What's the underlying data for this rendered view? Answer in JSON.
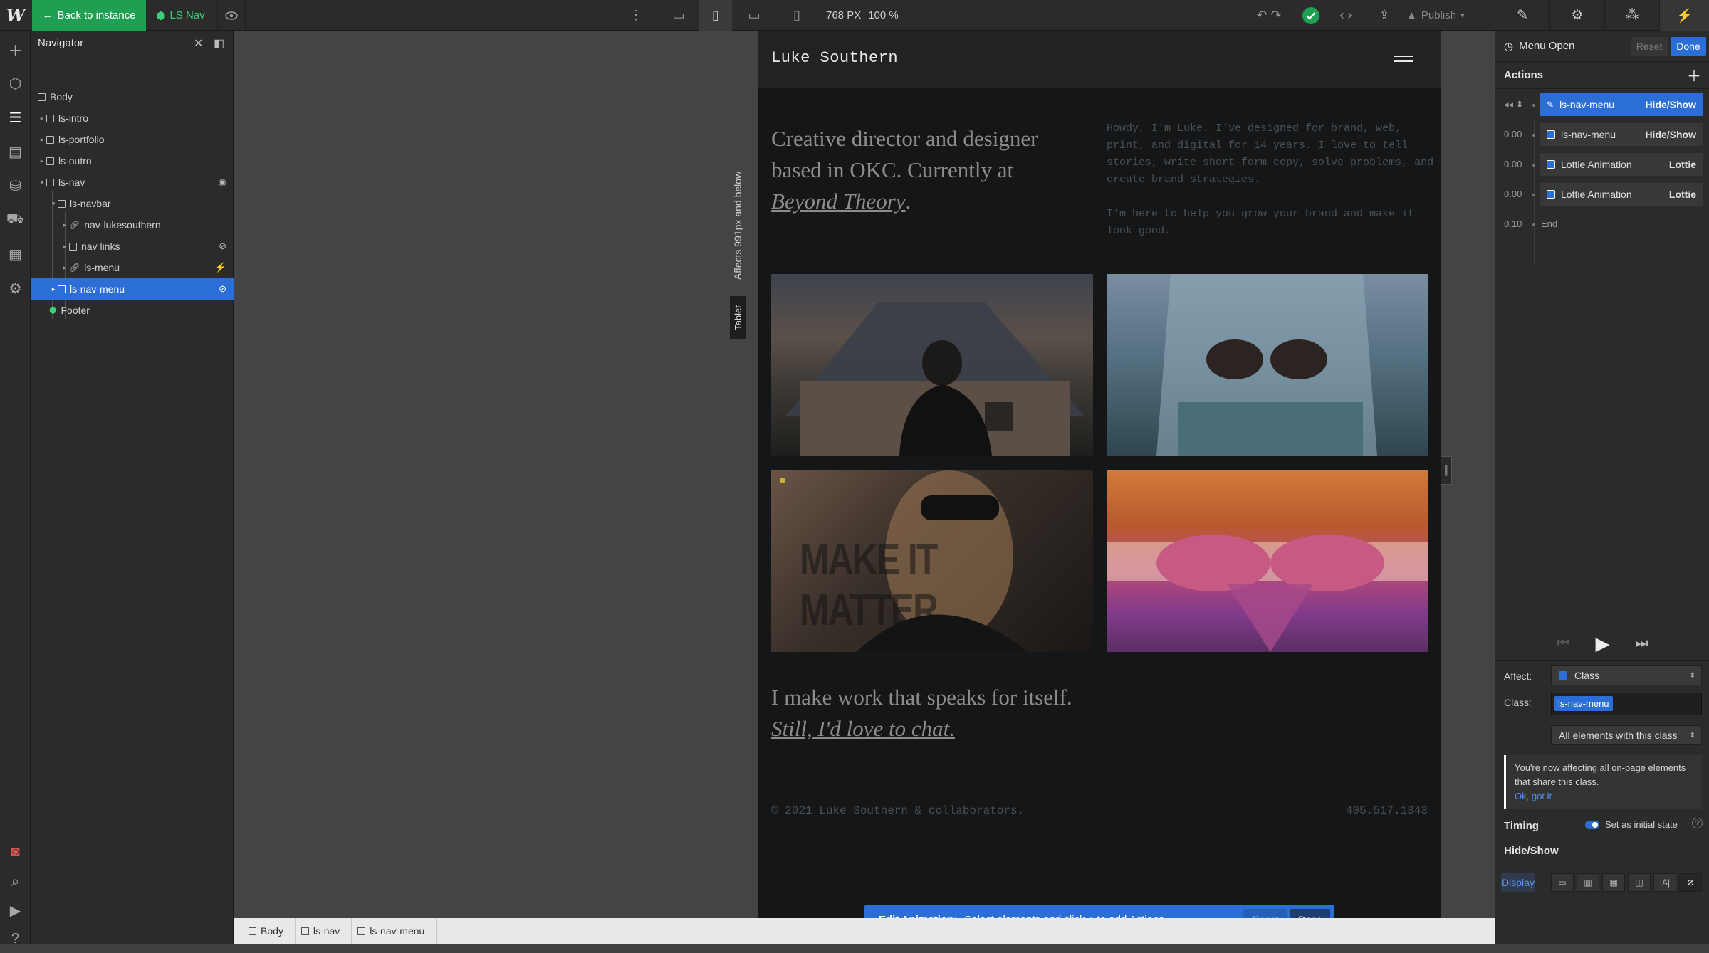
{
  "topbar": {
    "logo": "W",
    "back_label": "Back to instance",
    "symbol_name": "LS Nav",
    "canvas_width": "768 PX",
    "zoom": "100 %",
    "publish_label": "Publish"
  },
  "navigator": {
    "title": "Navigator",
    "items": [
      {
        "label": "Body"
      },
      {
        "label": "ls-intro"
      },
      {
        "label": "ls-portfolio"
      },
      {
        "label": "ls-outro"
      },
      {
        "label": "ls-nav"
      },
      {
        "label": "ls-navbar"
      },
      {
        "label": "nav-lukesouthern"
      },
      {
        "label": "nav links"
      },
      {
        "label": "ls-menu"
      },
      {
        "label": "ls-nav-menu"
      },
      {
        "label": "Footer"
      }
    ]
  },
  "breakpoint": {
    "affects": "Affects 991px and below",
    "device": "Tablet"
  },
  "site": {
    "brand": "Luke Southern",
    "hero_line1": "Creative director and designer based in OKC. Currently at",
    "hero_link": "Beyond Theory",
    "hero_end": ".",
    "intro_p1": "Howdy, I'm Luke. I've designed for brand, web, print, and digital for 14 years. I love to tell stories, write short form copy, solve problems, and create brand strategies.",
    "intro_p2": "I'm here to help you grow your brand and make it look good.",
    "photo3_text": "MAKE IT MATTER",
    "cta_line1": "I make work that speaks for itself.",
    "cta_link": "Still, I'd love to chat.",
    "copyright": "© 2021 Luke Southern & collaborators.",
    "phone": "405.517.1843"
  },
  "edit_bar": {
    "title": "Edit Animation:",
    "message": "Select elements and click + to add Actions",
    "reset": "Reset",
    "done": "Done"
  },
  "breadcrumbs": [
    {
      "label": "Body"
    },
    {
      "label": "ls-nav"
    },
    {
      "label": "ls-nav-menu"
    }
  ],
  "interactions": {
    "title": "Menu Open",
    "reset": "Reset",
    "done": "Done",
    "actions_label": "Actions",
    "actions": [
      {
        "time": "",
        "target": "ls-nav-menu",
        "type": "Hide/Show"
      },
      {
        "time": "0.00",
        "target": "ls-nav-menu",
        "type": "Hide/Show"
      },
      {
        "time": "0.00",
        "target": "Lottie Animation",
        "type": "Lottie"
      },
      {
        "time": "0.00",
        "target": "Lottie Animation",
        "type": "Lottie"
      }
    ],
    "end_time": "0.10",
    "end_label": "End",
    "affect_label": "Affect:",
    "affect_value": "Class",
    "class_label": "Class:",
    "class_value": "ls-nav-menu",
    "scope_value": "All elements with this class",
    "notice": "You're now affecting all on-page elements that share this class.",
    "notice_ok": "Ok, got it",
    "timing_label": "Timing",
    "initial_state_label": "Set as initial state",
    "hideshow_label": "Hide/Show",
    "display_label": "Display"
  }
}
